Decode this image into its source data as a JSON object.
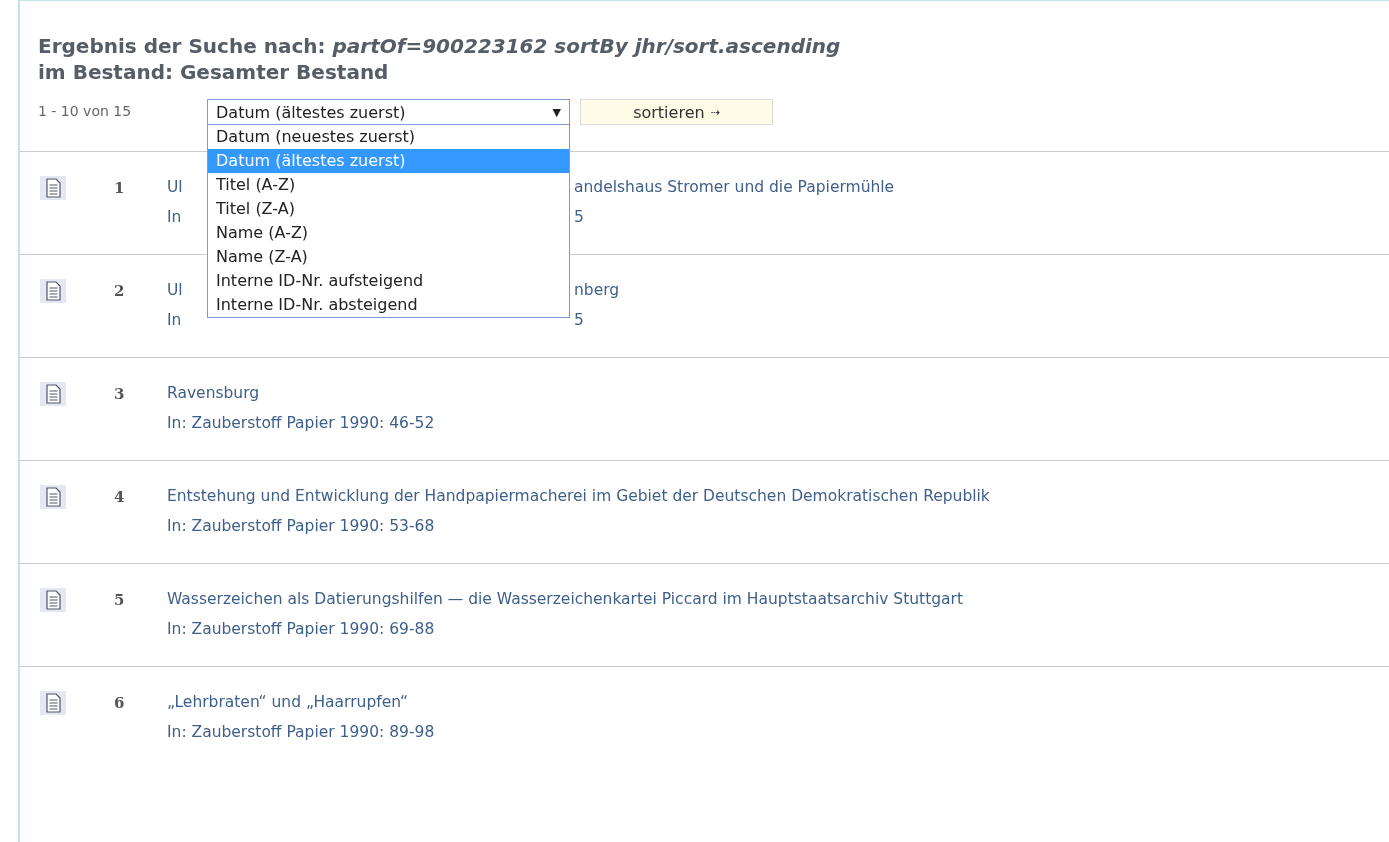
{
  "heading": {
    "prefix": "Ergebnis der Suche nach:",
    "query": "partOf=900223162 sortBy jhr/sort.ascending",
    "line2": "im Bestand: Gesamter Bestand"
  },
  "toolbar": {
    "count": "1 - 10 von 15",
    "sort_select": {
      "value": "Datum (ältestes zuerst)",
      "expanded": true,
      "arrow": "▼"
    },
    "sort_button": "sortieren",
    "button_arrow": "⇢"
  },
  "sort_options": [
    {
      "label": "Datum (neuestes zuerst)",
      "selected": false
    },
    {
      "label": "Datum (ältestes zuerst)",
      "selected": true
    },
    {
      "label": "Titel (A-Z)",
      "selected": false
    },
    {
      "label": "Titel (Z-A)",
      "selected": false
    },
    {
      "label": "Name (A-Z)",
      "selected": false
    },
    {
      "label": "Name (Z-A)",
      "selected": false
    },
    {
      "label": "Interne ID-Nr. aufsteigend",
      "selected": false
    },
    {
      "label": "Interne ID-Nr. absteigend",
      "selected": false
    }
  ],
  "results": [
    {
      "number": "1",
      "title_start": "Ul",
      "title_end": "andelshaus Stromer und die Papiermühle",
      "source_start": "In",
      "source_end": "5"
    },
    {
      "number": "2",
      "title_start": "Ul",
      "title_end": "nberg",
      "source_start": "In",
      "source_end": "5"
    },
    {
      "number": "3",
      "title": "Ravensburg",
      "source": "In: Zauberstoff Papier 1990: 46-52"
    },
    {
      "number": "4",
      "title": "Entstehung und Entwicklung der Handpapiermacherei im Gebiet der Deutschen Demokratischen Republik",
      "source": "In: Zauberstoff Papier 1990: 53-68"
    },
    {
      "number": "5",
      "title": "Wasserzeichen als Datierungshilfen — die Wasserzeichenkartei Piccard im Hauptstaatsarchiv Stuttgart",
      "source": "In: Zauberstoff Papier 1990: 69-88"
    },
    {
      "number": "6",
      "title": "„Lehrbraten“ und „Haarrupfen“",
      "source": "In: Zauberstoff Papier 1990: 89-98"
    }
  ]
}
